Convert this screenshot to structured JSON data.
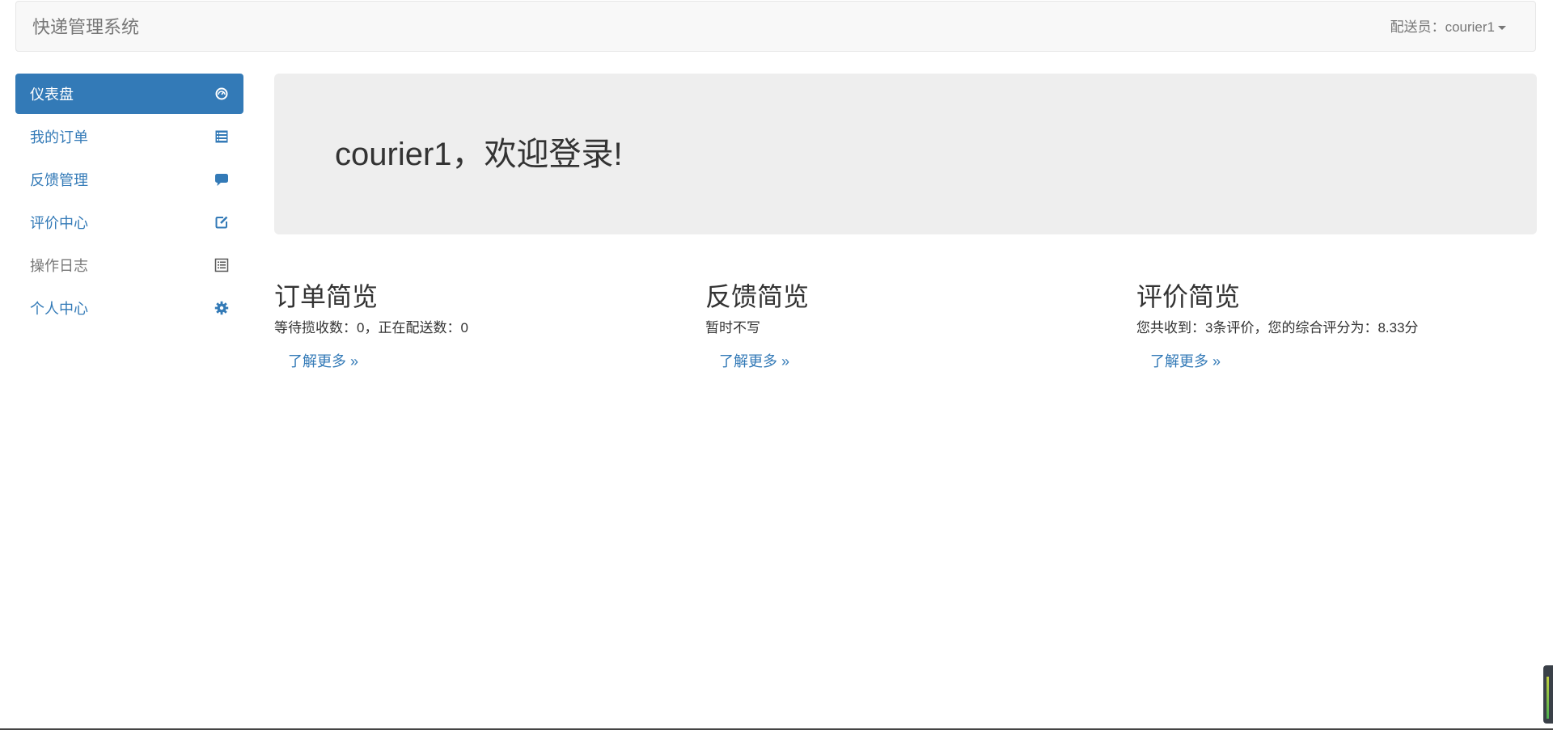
{
  "navbar": {
    "brand": "快递管理系统",
    "user_label": "配送员：courier1"
  },
  "sidebar": {
    "items": [
      {
        "label": "仪表盘",
        "icon": "dashboard-icon"
      },
      {
        "label": "我的订单",
        "icon": "list-icon"
      },
      {
        "label": "反馈管理",
        "icon": "comment-icon"
      },
      {
        "label": "评价中心",
        "icon": "edit-icon"
      },
      {
        "label": "操作日志",
        "icon": "list-alt-icon"
      },
      {
        "label": "个人中心",
        "icon": "cog-icon"
      }
    ]
  },
  "jumbotron": {
    "welcome": "courier1，欢迎登录!"
  },
  "overview": [
    {
      "title": "订单简览",
      "text": "等待揽收数：0，正在配送数：0",
      "link": "了解更多 »"
    },
    {
      "title": "反馈简览",
      "text": "暂时不写",
      "link": "了解更多 »"
    },
    {
      "title": "评价简览",
      "text": "您共收到：3条评价，您的综合评分为：8.33分",
      "link": "了解更多 »"
    }
  ],
  "colors": {
    "primary": "#337ab7",
    "navbar_bg": "#f8f8f8",
    "jumbotron_bg": "#eeeeee",
    "muted": "#777777"
  }
}
